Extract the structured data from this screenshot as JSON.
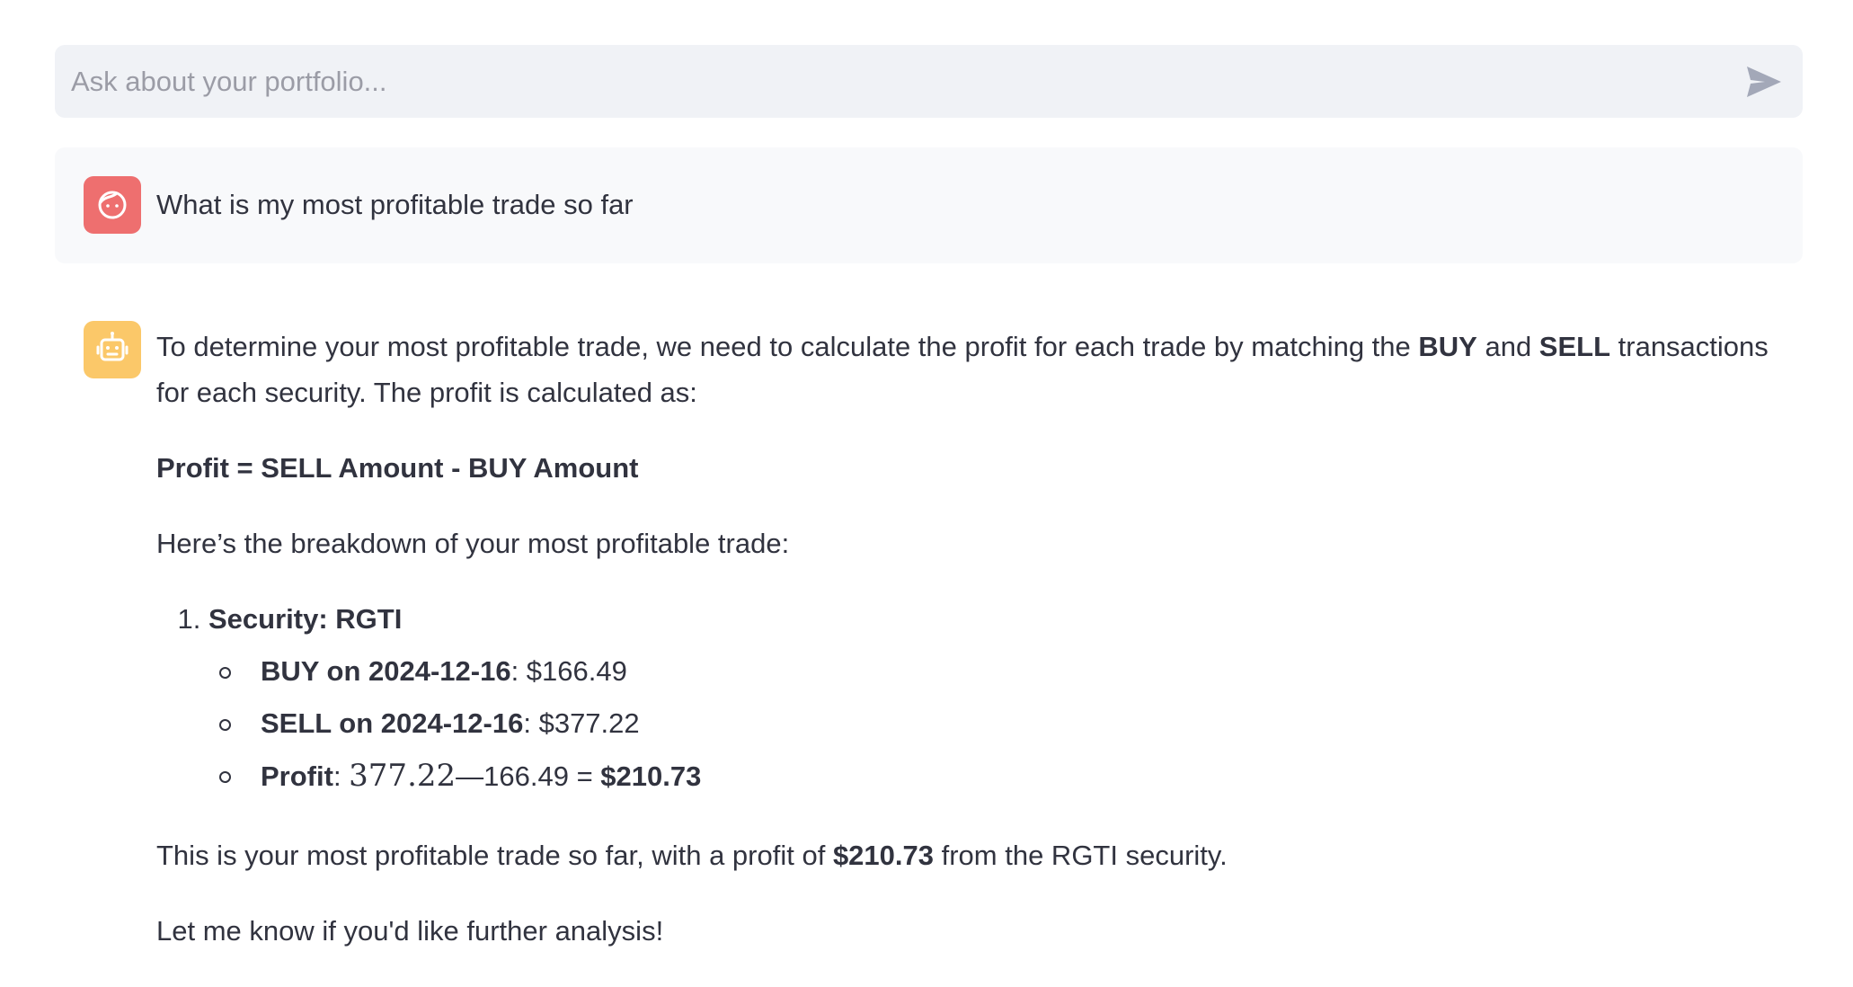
{
  "chat_input": {
    "placeholder": "Ask about your portfolio...",
    "value": ""
  },
  "user_message": {
    "avatar_icon": "user-face-icon",
    "text": "What is my most profitable trade so far"
  },
  "assistant_message": {
    "avatar_icon": "robot-icon",
    "intro": {
      "part1": "To determine your most profitable trade, we need to calculate the profit for each trade by matching the ",
      "buy": "BUY",
      "and": " and ",
      "sell": "SELL",
      "part2": " transactions for each security. The profit is calculated as:"
    },
    "formula": "Profit = SELL Amount - BUY Amount",
    "breakdown_intro": "Here’s the breakdown of your most profitable trade:",
    "items": [
      {
        "title": "Security: RGTI",
        "details": [
          {
            "label": "BUY on 2024-12-16",
            "sep": ":",
            "value": " $166.49"
          },
          {
            "label": "SELL on 2024-12-16",
            "sep": ":",
            "value": " $377.22"
          }
        ],
        "profit": {
          "label": "Profit",
          "sep": ": ",
          "math_value": "377.22",
          "dash": "—",
          "minus_value": "166.49 = ",
          "result": "$210.73"
        }
      }
    ],
    "summary": {
      "part1": "This is your most profitable trade so far, with a profit of ",
      "amount": "$210.73",
      "part2": " from the RGTI security."
    },
    "closing": "Let me know if you'd like further analysis!"
  },
  "colors": {
    "user_avatar_bg": "#ee6f6f",
    "assistant_avatar_bg": "#fbc869",
    "input_bg": "#f0f2f6",
    "user_message_bg": "#f8f9fb",
    "text": "#31333f"
  }
}
